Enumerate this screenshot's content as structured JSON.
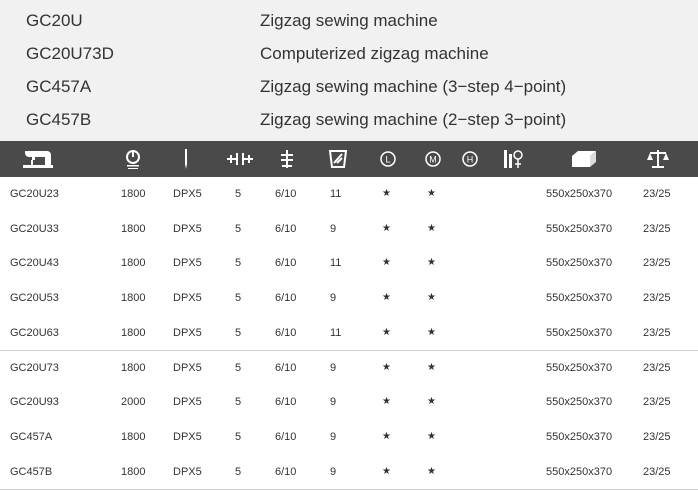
{
  "models": [
    {
      "code": "GC20U",
      "description": "Zigzag sewing machine"
    },
    {
      "code": "GC20U73D",
      "description": "Computerized zigzag machine"
    },
    {
      "code": "GC457A",
      "description": "Zigzag sewing machine (3−step 4−point)"
    },
    {
      "code": "GC457B",
      "description": "Zigzag sewing machine (2−step 3−point)"
    }
  ],
  "table": {
    "header_icons": [
      "sewing-machine-icon",
      "speed-icon",
      "needle-icon",
      "stitch-width-icon",
      "presser-height-icon",
      "feed-icon",
      "light-weight-icon",
      "medium-weight-icon",
      "heavy-weight-icon",
      "special-function-icon",
      "package-icon",
      "weight-scale-icon"
    ],
    "header_labels": {
      "L": "L",
      "M": "M",
      "H": "H"
    },
    "rows": [
      {
        "model": "GC20U23",
        "speed": "1800",
        "needle": "DPX5",
        "stitch": "5",
        "height": "6/10",
        "feed": "11",
        "light": "★",
        "medium": "★",
        "package": "550x250x370",
        "weight": "23/25"
      },
      {
        "model": "GC20U33",
        "speed": "1800",
        "needle": "DPX5",
        "stitch": "5",
        "height": "6/10",
        "feed": "9",
        "light": "★",
        "medium": "★",
        "package": "550x250x370",
        "weight": "23/25"
      },
      {
        "model": "GC20U43",
        "speed": "1800",
        "needle": "DPX5",
        "stitch": "5",
        "height": "6/10",
        "feed": "11",
        "light": "★",
        "medium": "★",
        "package": "550x250x370",
        "weight": "23/25"
      },
      {
        "model": "GC20U53",
        "speed": "1800",
        "needle": "DPX5",
        "stitch": "5",
        "height": "6/10",
        "feed": "9",
        "light": "★",
        "medium": "★",
        "package": "550x250x370",
        "weight": "23/25"
      },
      {
        "model": "GC20U63",
        "speed": "1800",
        "needle": "DPX5",
        "stitch": "5",
        "height": "6/10",
        "feed": "11",
        "light": "★",
        "medium": "★",
        "package": "550x250x370",
        "weight": "23/25"
      },
      {
        "model": "GC20U73",
        "speed": "1800",
        "needle": "DPX5",
        "stitch": "5",
        "height": "6/10",
        "feed": "9",
        "light": "★",
        "medium": "★",
        "package": "550x250x370",
        "weight": "23/25"
      },
      {
        "model": "GC20U93",
        "speed": "2000",
        "needle": "DPX5",
        "stitch": "5",
        "height": "6/10",
        "feed": "9",
        "light": "★",
        "medium": "★",
        "package": "550x250x370",
        "weight": "23/25"
      },
      {
        "model": "GC457A",
        "speed": "1800",
        "needle": "DPX5",
        "stitch": "5",
        "height": "6/10",
        "feed": "9",
        "light": "★",
        "medium": "★",
        "package": "550x250x370",
        "weight": "23/25"
      },
      {
        "model": "GC457B",
        "speed": "1800",
        "needle": "DPX5",
        "stitch": "5",
        "height": "6/10",
        "feed": "9",
        "light": "★",
        "medium": "★",
        "package": "550x250x370",
        "weight": "23/25"
      }
    ]
  },
  "colors": {
    "header_bg": "#4a4a4a",
    "icon": "#ffffff",
    "model_band_bg": "#f1f1f1",
    "row_alt_bg": "#f6f6f6"
  }
}
